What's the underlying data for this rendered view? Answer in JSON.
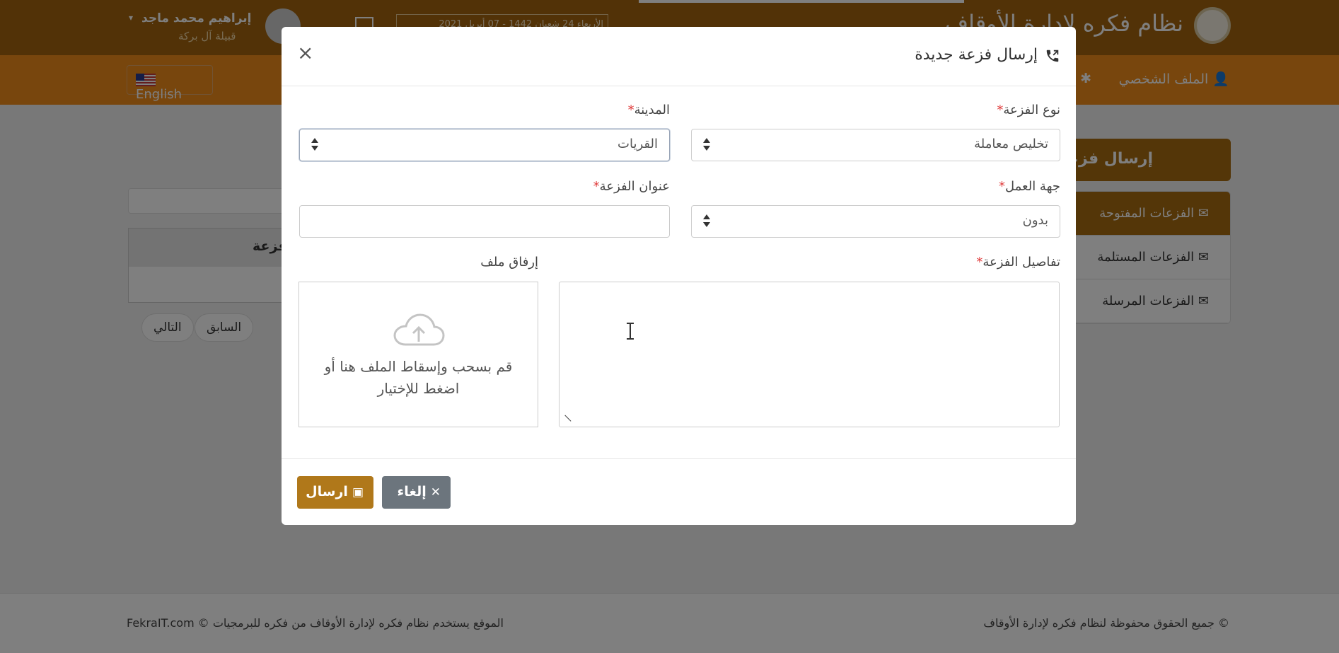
{
  "header": {
    "system_title": "نظام فكره لإدارة الأوقاف",
    "user_name": "إبراهيم محمد ماجد",
    "user_subtitle": "قبيلة آل بركة",
    "date_text": "الأربعاء 24 شعبان 1442 - 07 أبريل 2021"
  },
  "nav": {
    "language_button": "English",
    "profile_link": "الملف الشخصي"
  },
  "sidebar": {
    "send_button": "إرسال فزعة",
    "items": [
      {
        "label": "الفزعات المفتوحة",
        "active": true
      },
      {
        "label": "الفزعات المستلمة",
        "active": false
      },
      {
        "label": "الفزعات المرسلة",
        "active": false
      }
    ]
  },
  "main": {
    "table_header": "فزعة",
    "prev_button": "السابق",
    "next_button": "التالي"
  },
  "footer": {
    "left_text": "الموقع يستخدم نظام فكره لإدارة الأوقاف من فكره للبرمجيات © FekraIT.com",
    "right_text": "© جميع الحقوق محفوظة لنظام فكره لإدارة الأوقاف"
  },
  "modal": {
    "title": "إرسال فزعة جديدة",
    "close_symbol": "×",
    "fields": {
      "type": {
        "label": "نوع الفزعة",
        "value": "تخليص معاملة"
      },
      "city": {
        "label": "المدينة",
        "value": "القريات"
      },
      "work_entity": {
        "label": "جهة العمل",
        "value": "بدون"
      },
      "title": {
        "label": "عنوان الفزعة",
        "value": ""
      },
      "details": {
        "label": "تفاصيل الفزعة",
        "value": ""
      },
      "attachment": {
        "label": "إرفاق ملف",
        "dropzone_text": "قم بسحب وإسقاط الملف هنا أو اضغط للإختيار"
      }
    },
    "required_mark": "*",
    "buttons": {
      "send": "ارسال",
      "cancel": "إلغاء"
    }
  },
  "colors": {
    "brand_brown": "#a96c11",
    "brand_orange": "#f08d1b",
    "send_button": "#b0781a",
    "cancel_button": "#6c757d",
    "required": "#e03c3c"
  }
}
